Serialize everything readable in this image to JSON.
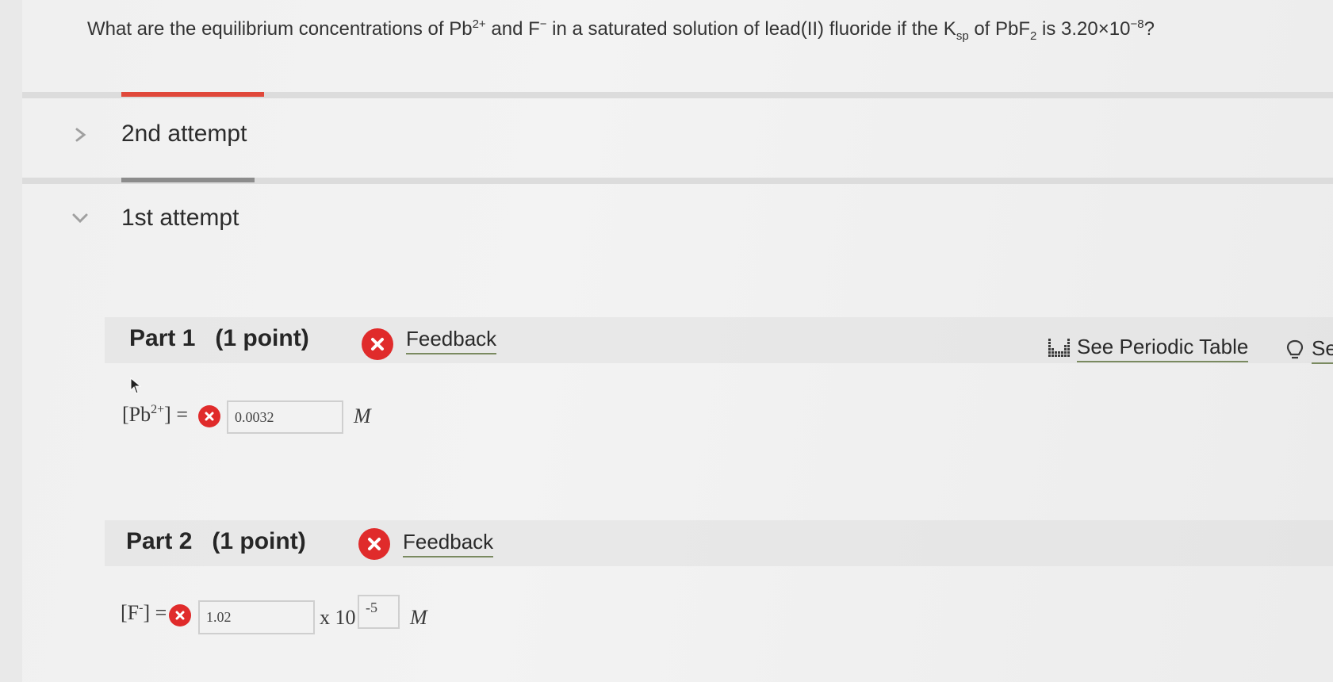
{
  "question": {
    "t1": "What are the equilibrium concentrations of Pb",
    "pb_charge": "2+",
    "t2": " and F",
    "f_charge": "−",
    "t3": " in a saturated solution of lead(II) fluoride if the K",
    "ksp_sub": "sp",
    "t4": " of PbF",
    "pbf_sub": "2",
    "t5": " is 3.20×10",
    "exp": "−8",
    "t6": "?"
  },
  "attempts": [
    {
      "label": "2nd attempt",
      "expanded": false
    },
    {
      "label": "1st attempt",
      "expanded": true
    }
  ],
  "part1": {
    "title": "Part 1   (1 point)",
    "feedback": "Feedback",
    "label_open": "[Pb",
    "label_sup": "2+",
    "label_close": "] =",
    "value": "0.0032",
    "unit": "M"
  },
  "part2": {
    "title": "Part 2   (1 point)",
    "feedback": "Feedback",
    "label_open": "[F",
    "label_sup": "-",
    "label_close": "] =",
    "value": "1.02",
    "times_ten": "x 10",
    "exponent": "-5",
    "unit": "M"
  },
  "tools": {
    "periodic_table": "See Periodic Table",
    "hint_partial": "Se"
  },
  "colors": {
    "error_red": "#e02b2b",
    "active_accent": "#e0483a",
    "inactive_accent": "#8c8c8c",
    "link_underline": "#7a8a60"
  }
}
